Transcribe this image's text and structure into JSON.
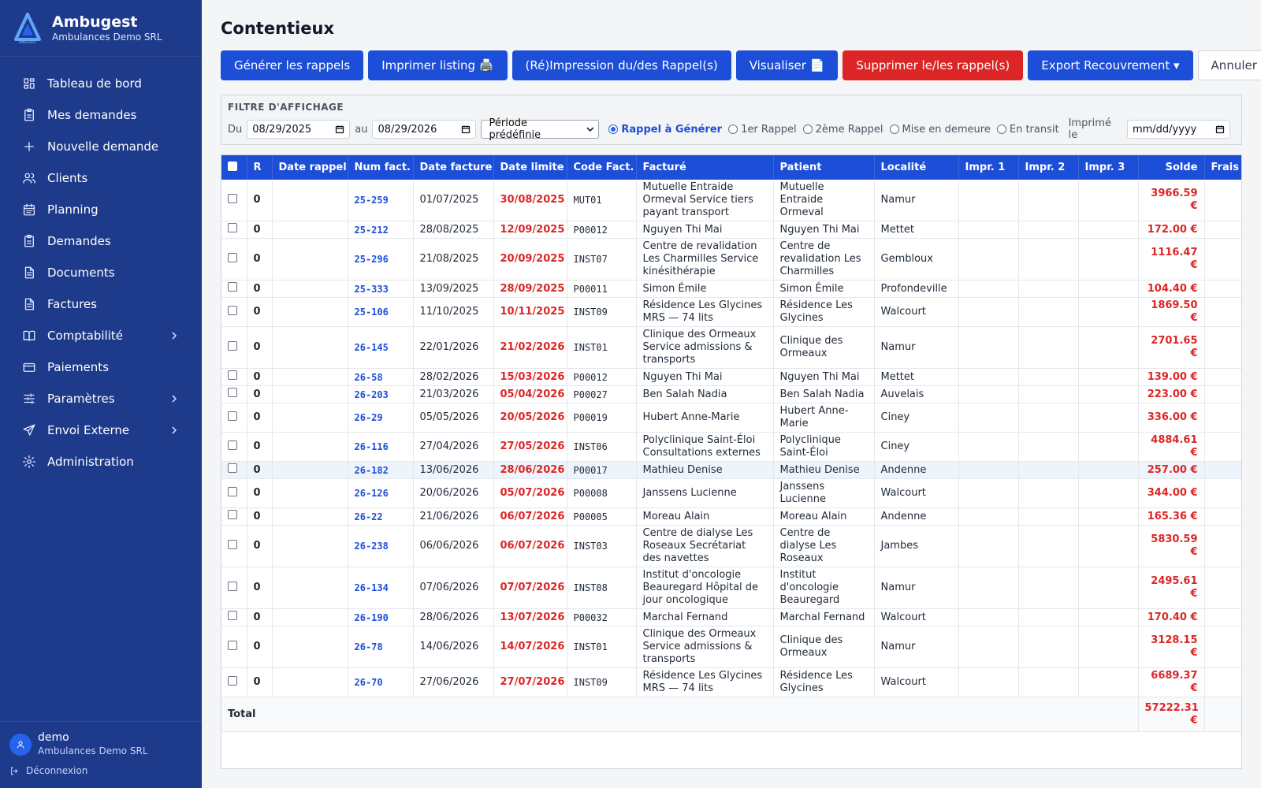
{
  "app": {
    "name": "Ambugest",
    "company": "Ambulances Demo SRL",
    "logo_text": "AMBUGEST"
  },
  "sidebar": {
    "items": [
      {
        "label": "Tableau de bord",
        "icon": "dashboard-icon"
      },
      {
        "label": "Mes demandes",
        "icon": "clipboard-icon"
      },
      {
        "label": "Nouvelle demande",
        "icon": "plus-icon"
      },
      {
        "label": "Clients",
        "icon": "users-icon"
      },
      {
        "label": "Planning",
        "icon": "calendar-icon"
      },
      {
        "label": "Demandes",
        "icon": "clipboard-icon"
      },
      {
        "label": "Documents",
        "icon": "document-icon"
      },
      {
        "label": "Factures",
        "icon": "document-icon"
      },
      {
        "label": "Comptabilité",
        "icon": "book-icon",
        "expandable": true
      },
      {
        "label": "Paiements",
        "icon": "card-icon"
      },
      {
        "label": "Paramètres",
        "icon": "sliders-icon",
        "expandable": true
      },
      {
        "label": "Envoi Externe",
        "icon": "send-icon",
        "expandable": true
      },
      {
        "label": "Administration",
        "icon": "gear-icon"
      }
    ]
  },
  "user": {
    "name": "demo",
    "company": "Ambulances Demo SRL",
    "logout": "Déconnexion"
  },
  "page": {
    "title": "Contentieux"
  },
  "toolbar": {
    "generate": "Générer les rappels",
    "print_listing": "Imprimer listing 🖨️",
    "reprint": "(Ré)Impression du/des Rappel(s)",
    "visualize": "Visualiser 📄",
    "delete": "Supprimer le/les rappel(s)",
    "export": "Export Recouvrement ▾",
    "cancel": "Annuler (ESC)"
  },
  "filter": {
    "title": "FILTRE D'AFFICHAGE",
    "from_label": "Du",
    "from_value": "08/29/2025",
    "to_label": "au",
    "to_value": "08/29/2026",
    "period": "Période prédéfinie",
    "radios": [
      {
        "label": "Rappel à Générer",
        "selected": true
      },
      {
        "label": "1er Rappel",
        "selected": false
      },
      {
        "label": "2ème Rappel",
        "selected": false
      },
      {
        "label": "Mise en demeure",
        "selected": false
      },
      {
        "label": "En transit",
        "selected": false
      }
    ],
    "printed_label": "Imprimé le",
    "printed_placeholder": "mm/dd/yyyy"
  },
  "table": {
    "headers": [
      "",
      "R",
      "Date rappel",
      "Num fact.",
      "Date facture",
      "Date limite",
      "Code Fact.",
      "Facturé",
      "Patient",
      "Localité",
      "Impr. 1",
      "Impr. 2",
      "Impr. 3",
      "Solde",
      "Frais"
    ],
    "rows": [
      {
        "r": "0",
        "num": "25-259",
        "date_facture": "01/07/2025",
        "date_limite": "30/08/2025",
        "code": "MUT01",
        "facture": "Mutuelle Entraide Ormeval Service tiers payant transport",
        "patient": "Mutuelle Entraide Ormeval",
        "localite": "Namur",
        "solde": "3966.59 €"
      },
      {
        "r": "0",
        "num": "25-212",
        "date_facture": "28/08/2025",
        "date_limite": "12/09/2025",
        "code": "P00012",
        "facture": "Nguyen Thi Mai",
        "patient": "Nguyen Thi Mai",
        "localite": "Mettet",
        "solde": "172.00 €"
      },
      {
        "r": "0",
        "num": "25-296",
        "date_facture": "21/08/2025",
        "date_limite": "20/09/2025",
        "code": "INST07",
        "facture": "Centre de revalidation Les Charmilles Service kinésithérapie",
        "patient": "Centre de revalidation Les Charmilles",
        "localite": "Gembloux",
        "solde": "1116.47 €"
      },
      {
        "r": "0",
        "num": "25-333",
        "date_facture": "13/09/2025",
        "date_limite": "28/09/2025",
        "code": "P00011",
        "facture": "Simon Émile",
        "patient": "Simon Émile",
        "localite": "Profondeville",
        "solde": "104.40 €"
      },
      {
        "r": "0",
        "num": "25-106",
        "date_facture": "11/10/2025",
        "date_limite": "10/11/2025",
        "code": "INST09",
        "facture": "Résidence Les Glycines MRS — 74 lits",
        "patient": "Résidence Les Glycines",
        "localite": "Walcourt",
        "solde": "1869.50 €"
      },
      {
        "r": "0",
        "num": "26-145",
        "date_facture": "22/01/2026",
        "date_limite": "21/02/2026",
        "code": "INST01",
        "facture": "Clinique des Ormeaux Service admissions & transports",
        "patient": "Clinique des Ormeaux",
        "localite": "Namur",
        "solde": "2701.65 €"
      },
      {
        "r": "0",
        "num": "26-58",
        "date_facture": "28/02/2026",
        "date_limite": "15/03/2026",
        "code": "P00012",
        "facture": "Nguyen Thi Mai",
        "patient": "Nguyen Thi Mai",
        "localite": "Mettet",
        "solde": "139.00 €"
      },
      {
        "r": "0",
        "num": "26-203",
        "date_facture": "21/03/2026",
        "date_limite": "05/04/2026",
        "code": "P00027",
        "facture": "Ben Salah Nadia",
        "patient": "Ben Salah Nadia",
        "localite": "Auvelais",
        "solde": "223.00 €"
      },
      {
        "r": "0",
        "num": "26-29",
        "date_facture": "05/05/2026",
        "date_limite": "20/05/2026",
        "code": "P00019",
        "facture": "Hubert Anne-Marie",
        "patient": "Hubert Anne-Marie",
        "localite": "Ciney",
        "solde": "336.00 €"
      },
      {
        "r": "0",
        "num": "26-116",
        "date_facture": "27/04/2026",
        "date_limite": "27/05/2026",
        "code": "INST06",
        "facture": "Polyclinique Saint-Éloi Consultations externes",
        "patient": "Polyclinique Saint-Éloi",
        "localite": "Ciney",
        "solde": "4884.61 €"
      },
      {
        "r": "0",
        "num": "26-182",
        "date_facture": "13/06/2026",
        "date_limite": "28/06/2026",
        "code": "P00017",
        "facture": "Mathieu Denise",
        "patient": "Mathieu Denise",
        "localite": "Andenne",
        "solde": "257.00 €",
        "highlight": true
      },
      {
        "r": "0",
        "num": "26-126",
        "date_facture": "20/06/2026",
        "date_limite": "05/07/2026",
        "code": "P00008",
        "facture": "Janssens Lucienne",
        "patient": "Janssens Lucienne",
        "localite": "Walcourt",
        "solde": "344.00 €"
      },
      {
        "r": "0",
        "num": "26-22",
        "date_facture": "21/06/2026",
        "date_limite": "06/07/2026",
        "code": "P00005",
        "facture": "Moreau Alain",
        "patient": "Moreau Alain",
        "localite": "Andenne",
        "solde": "165.36 €"
      },
      {
        "r": "0",
        "num": "26-238",
        "date_facture": "06/06/2026",
        "date_limite": "06/07/2026",
        "code": "INST03",
        "facture": "Centre de dialyse Les Roseaux Secrétariat des navettes",
        "patient": "Centre de dialyse Les Roseaux",
        "localite": "Jambes",
        "solde": "5830.59 €"
      },
      {
        "r": "0",
        "num": "26-134",
        "date_facture": "07/06/2026",
        "date_limite": "07/07/2026",
        "code": "INST08",
        "facture": "Institut d'oncologie Beauregard Hôpital de jour oncologique",
        "patient": "Institut d'oncologie Beauregard",
        "localite": "Namur",
        "solde": "2495.61 €"
      },
      {
        "r": "0",
        "num": "26-190",
        "date_facture": "28/06/2026",
        "date_limite": "13/07/2026",
        "code": "P00032",
        "facture": "Marchal Fernand",
        "patient": "Marchal Fernand",
        "localite": "Walcourt",
        "solde": "170.40 €"
      },
      {
        "r": "0",
        "num": "26-78",
        "date_facture": "14/06/2026",
        "date_limite": "14/07/2026",
        "code": "INST01",
        "facture": "Clinique des Ormeaux Service admissions & transports",
        "patient": "Clinique des Ormeaux",
        "localite": "Namur",
        "solde": "3128.15 €"
      },
      {
        "r": "0",
        "num": "26-70",
        "date_facture": "27/06/2026",
        "date_limite": "27/07/2026",
        "code": "INST09",
        "facture": "Résidence Les Glycines MRS — 74 lits",
        "patient": "Résidence Les Glycines",
        "localite": "Walcourt",
        "solde": "6689.37 €"
      }
    ],
    "total_label": "Total",
    "total_value": "57222.31 €"
  },
  "colors": {
    "sidebar": "#1e3a8a",
    "primary": "#1d4ed8",
    "danger": "#dc2626"
  }
}
